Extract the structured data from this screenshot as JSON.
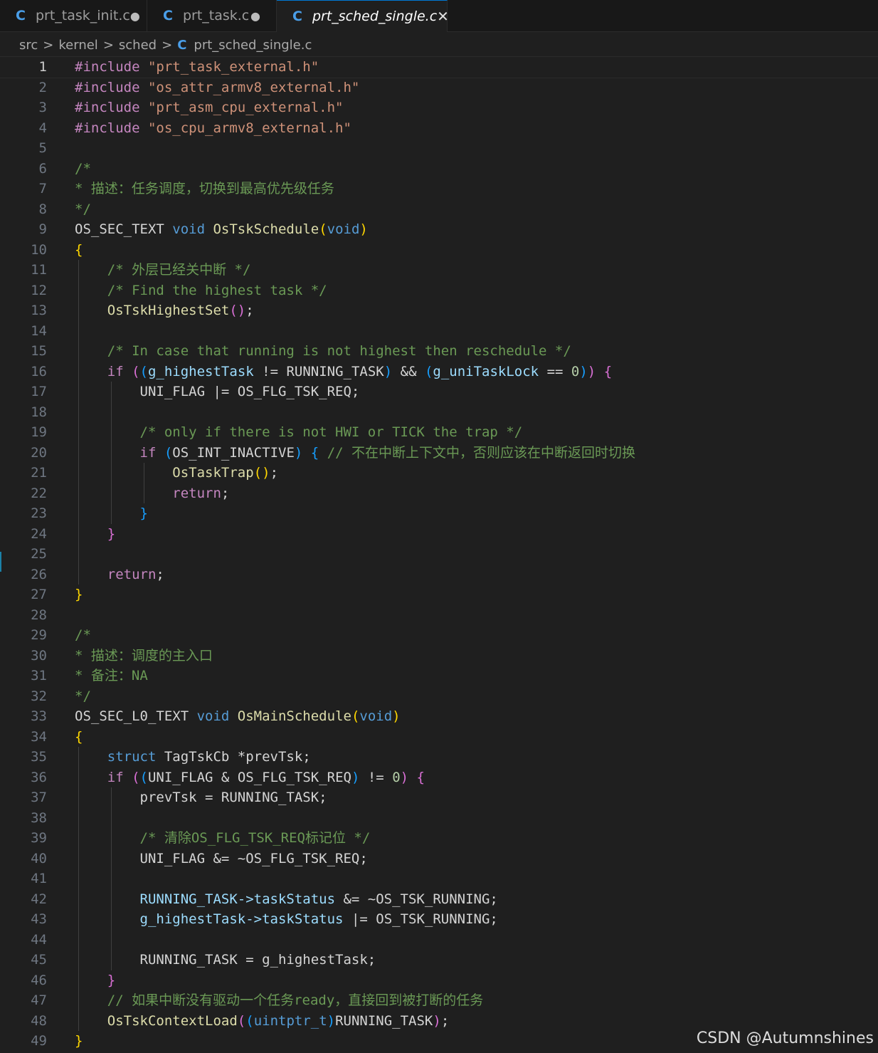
{
  "tabs": [
    {
      "icon": "C",
      "label": "prt_task_init.c",
      "end": "●"
    },
    {
      "icon": "C",
      "label": "prt_task.c",
      "end": "●"
    },
    {
      "icon": "C",
      "label": "prt_sched_single.c",
      "end": "✕"
    }
  ],
  "breadcrumb": {
    "parts": [
      "src",
      "kernel",
      "sched"
    ],
    "separator": ">",
    "file_icon": "C",
    "file": "prt_sched_single.c"
  },
  "editor": {
    "current_line": 1,
    "lines": [
      {
        "n": "1",
        "indent": 0,
        "t": [
          [
            "pp",
            "#include "
          ],
          [
            "str",
            "\"prt_task_external.h\""
          ]
        ]
      },
      {
        "n": "2",
        "indent": 0,
        "t": [
          [
            "pp",
            "#include "
          ],
          [
            "str",
            "\"os_attr_armv8_external.h\""
          ]
        ]
      },
      {
        "n": "3",
        "indent": 0,
        "t": [
          [
            "pp",
            "#include "
          ],
          [
            "str",
            "\"prt_asm_cpu_external.h\""
          ]
        ]
      },
      {
        "n": "4",
        "indent": 0,
        "t": [
          [
            "pp",
            "#include "
          ],
          [
            "str",
            "\"os_cpu_armv8_external.h\""
          ]
        ]
      },
      {
        "n": "5",
        "indent": 0,
        "t": []
      },
      {
        "n": "6",
        "indent": 0,
        "t": [
          [
            "cm",
            "/*"
          ]
        ]
      },
      {
        "n": "7",
        "indent": 0,
        "t": [
          [
            "cm",
            "* 描述：任务调度，切换到最高优先级任务"
          ]
        ]
      },
      {
        "n": "8",
        "indent": 0,
        "t": [
          [
            "cm",
            "*/"
          ]
        ]
      },
      {
        "n": "9",
        "indent": 0,
        "t": [
          [
            "mac",
            "OS_SEC_TEXT "
          ],
          [
            "kw",
            "void "
          ],
          [
            "fn",
            "OsTskSchedule"
          ],
          [
            "b1",
            "("
          ],
          [
            "kw",
            "void"
          ],
          [
            "b1",
            ")"
          ]
        ]
      },
      {
        "n": "10",
        "indent": 0,
        "t": [
          [
            "b1",
            "{"
          ]
        ]
      },
      {
        "n": "11",
        "indent": 1,
        "t": [
          [
            "cm",
            "    /* 外层已经关中断 */"
          ]
        ]
      },
      {
        "n": "12",
        "indent": 1,
        "t": [
          [
            "cm",
            "    /* Find the highest task */"
          ]
        ]
      },
      {
        "n": "13",
        "indent": 1,
        "t": [
          [
            "fn",
            "    OsTskHighestSet"
          ],
          [
            "b2",
            "()"
          ],
          [
            "plain",
            ";"
          ]
        ]
      },
      {
        "n": "14",
        "indent": 1,
        "t": []
      },
      {
        "n": "15",
        "indent": 1,
        "t": [
          [
            "cm",
            "    /* In case that running is not highest then reschedule */"
          ]
        ]
      },
      {
        "n": "16",
        "indent": 1,
        "t": [
          [
            "ctl",
            "    if "
          ],
          [
            "b2",
            "("
          ],
          [
            "b3",
            "("
          ],
          [
            "var",
            "g_highestTask"
          ],
          [
            "plain",
            " != RUNNING_TASK"
          ],
          [
            "b3",
            ")"
          ],
          [
            "plain",
            " && "
          ],
          [
            "b3",
            "("
          ],
          [
            "var",
            "g_uniTaskLock"
          ],
          [
            "plain",
            " == "
          ],
          [
            "num",
            "0"
          ],
          [
            "b3",
            ")"
          ],
          [
            "b2",
            ")"
          ],
          [
            "plain",
            " "
          ],
          [
            "b2",
            "{"
          ]
        ]
      },
      {
        "n": "17",
        "indent": 2,
        "t": [
          [
            "mac",
            "        UNI_FLAG |= OS_FLG_TSK_REQ;"
          ]
        ]
      },
      {
        "n": "18",
        "indent": 2,
        "t": []
      },
      {
        "n": "19",
        "indent": 2,
        "t": [
          [
            "cm",
            "        /* only if there is not HWI or TICK the trap */"
          ]
        ]
      },
      {
        "n": "20",
        "indent": 2,
        "t": [
          [
            "ctl",
            "        if "
          ],
          [
            "b3",
            "("
          ],
          [
            "mac",
            "OS_INT_INACTIVE"
          ],
          [
            "b3",
            ")"
          ],
          [
            "plain",
            " "
          ],
          [
            "b3",
            "{"
          ],
          [
            "cm",
            " // 不在中断上下文中，否则应该在中断返回时切换"
          ]
        ]
      },
      {
        "n": "21",
        "indent": 3,
        "t": [
          [
            "fn",
            "            OsTaskTrap"
          ],
          [
            "b1",
            "()"
          ],
          [
            "plain",
            ";"
          ]
        ]
      },
      {
        "n": "22",
        "indent": 3,
        "t": [
          [
            "ctl",
            "            return"
          ],
          [
            "plain",
            ";"
          ]
        ]
      },
      {
        "n": "23",
        "indent": 2,
        "t": [
          [
            "b3",
            "        }"
          ]
        ]
      },
      {
        "n": "24",
        "indent": 1,
        "t": [
          [
            "b2",
            "    }"
          ]
        ]
      },
      {
        "n": "25",
        "indent": 1,
        "t": []
      },
      {
        "n": "26",
        "indent": 1,
        "t": [
          [
            "ctl",
            "    return"
          ],
          [
            "plain",
            ";"
          ]
        ]
      },
      {
        "n": "27",
        "indent": 0,
        "t": [
          [
            "b1",
            "}"
          ]
        ]
      },
      {
        "n": "28",
        "indent": 0,
        "t": []
      },
      {
        "n": "29",
        "indent": 0,
        "t": [
          [
            "cm",
            "/*"
          ]
        ]
      },
      {
        "n": "30",
        "indent": 0,
        "t": [
          [
            "cm",
            "* 描述：调度的主入口"
          ]
        ]
      },
      {
        "n": "31",
        "indent": 0,
        "t": [
          [
            "cm",
            "* 备注：NA"
          ]
        ]
      },
      {
        "n": "32",
        "indent": 0,
        "t": [
          [
            "cm",
            "*/"
          ]
        ]
      },
      {
        "n": "33",
        "indent": 0,
        "t": [
          [
            "mac",
            "OS_SEC_L0_TEXT "
          ],
          [
            "kw",
            "void "
          ],
          [
            "fn",
            "OsMainSchedule"
          ],
          [
            "b1",
            "("
          ],
          [
            "kw",
            "void"
          ],
          [
            "b1",
            ")"
          ]
        ]
      },
      {
        "n": "34",
        "indent": 0,
        "t": [
          [
            "b1",
            "{"
          ]
        ]
      },
      {
        "n": "35",
        "indent": 1,
        "t": [
          [
            "kw",
            "    struct "
          ],
          [
            "plain",
            "TagTskCb *prevTsk;"
          ]
        ]
      },
      {
        "n": "36",
        "indent": 1,
        "t": [
          [
            "ctl",
            "    if "
          ],
          [
            "b2",
            "("
          ],
          [
            "b3",
            "("
          ],
          [
            "mac",
            "UNI_FLAG & OS_FLG_TSK_REQ"
          ],
          [
            "b3",
            ")"
          ],
          [
            "plain",
            " != "
          ],
          [
            "num",
            "0"
          ],
          [
            "b2",
            ")"
          ],
          [
            "plain",
            " "
          ],
          [
            "b2",
            "{"
          ]
        ]
      },
      {
        "n": "37",
        "indent": 2,
        "t": [
          [
            "plain",
            "        prevTsk = RUNNING_TASK;"
          ]
        ]
      },
      {
        "n": "38",
        "indent": 2,
        "t": []
      },
      {
        "n": "39",
        "indent": 2,
        "t": [
          [
            "cm",
            "        /* 清除OS_FLG_TSK_REQ标记位 */"
          ]
        ]
      },
      {
        "n": "40",
        "indent": 2,
        "t": [
          [
            "mac",
            "        UNI_FLAG &= ~OS_FLG_TSK_REQ;"
          ]
        ]
      },
      {
        "n": "41",
        "indent": 2,
        "t": []
      },
      {
        "n": "42",
        "indent": 2,
        "t": [
          [
            "var",
            "        RUNNING_TASK->taskStatus"
          ],
          [
            "plain",
            " &= ~OS_TSK_RUNNING;"
          ]
        ]
      },
      {
        "n": "43",
        "indent": 2,
        "t": [
          [
            "var",
            "        g_highestTask->taskStatus"
          ],
          [
            "plain",
            " |= OS_TSK_RUNNING;"
          ]
        ]
      },
      {
        "n": "44",
        "indent": 2,
        "t": []
      },
      {
        "n": "45",
        "indent": 2,
        "t": [
          [
            "plain",
            "        RUNNING_TASK = g_highestTask;"
          ]
        ]
      },
      {
        "n": "46",
        "indent": 1,
        "t": [
          [
            "b2",
            "    }"
          ]
        ]
      },
      {
        "n": "47",
        "indent": 1,
        "t": [
          [
            "cm",
            "    // 如果中断没有驱动一个任务ready，直接回到被打断的任务"
          ]
        ]
      },
      {
        "n": "48",
        "indent": 1,
        "t": [
          [
            "fn",
            "    OsTskContextLoad"
          ],
          [
            "b2",
            "("
          ],
          [
            "b3",
            "("
          ],
          [
            "kw",
            "uintptr_t"
          ],
          [
            "b3",
            ")"
          ],
          [
            "plain",
            "RUNNING_TASK"
          ],
          [
            "b2",
            ")"
          ],
          [
            "plain",
            ";"
          ]
        ]
      },
      {
        "n": "49",
        "indent": 0,
        "t": [
          [
            "b1",
            "}"
          ]
        ]
      }
    ]
  },
  "watermark": "CSDN @Autumnshines"
}
